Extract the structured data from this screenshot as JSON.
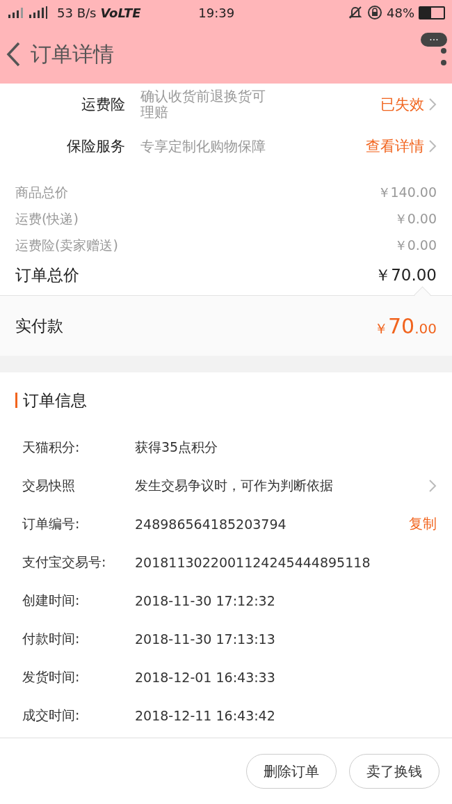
{
  "status_bar": {
    "network_speed": "53 B/s",
    "volte": "VoLTE",
    "time": "19:39",
    "battery": "48%"
  },
  "header": {
    "title": "订单详情",
    "more_badge": "···"
  },
  "services": [
    {
      "label": "运费险",
      "description": "确认收货前退换货可理赔",
      "action": "已失效"
    },
    {
      "label": "保险服务",
      "description": "专享定制化购物保障",
      "action": "查看详情"
    }
  ],
  "price_lines": [
    {
      "label": "商品总价",
      "amount": "￥140.00",
      "kind": "minor"
    },
    {
      "label": "运费(快递)",
      "amount": "￥0.00",
      "kind": "minor"
    },
    {
      "label": "运费险(卖家赠送)",
      "amount": "￥0.00",
      "kind": "minor"
    },
    {
      "label": "订单总价",
      "amount": "￥70.00",
      "kind": "total"
    }
  ],
  "paid": {
    "label": "实付款",
    "currency": "￥",
    "integer": "70",
    "decimal": ".00"
  },
  "order_info": {
    "title": "订单信息",
    "rows": [
      {
        "label": "天猫积分:",
        "value": "获得35点积分"
      },
      {
        "label": "交易快照",
        "value": "发生交易争议时，可作为判断依据",
        "kind": "link"
      },
      {
        "label": "订单编号:",
        "value": "248986564185203794",
        "action": "复制"
      },
      {
        "label": "支付宝交易号:",
        "value": "2018113022001124245444895118"
      },
      {
        "label": "创建时间:",
        "value": "2018-11-30 17:12:32"
      },
      {
        "label": "付款时间:",
        "value": "2018-11-30 17:13:13"
      },
      {
        "label": "发货时间:",
        "value": "2018-12-01 16:43:33"
      },
      {
        "label": "成交时间:",
        "value": "2018-12-11 16:43:42"
      }
    ]
  },
  "buttons": [
    "删除订单",
    "卖了换钱"
  ]
}
